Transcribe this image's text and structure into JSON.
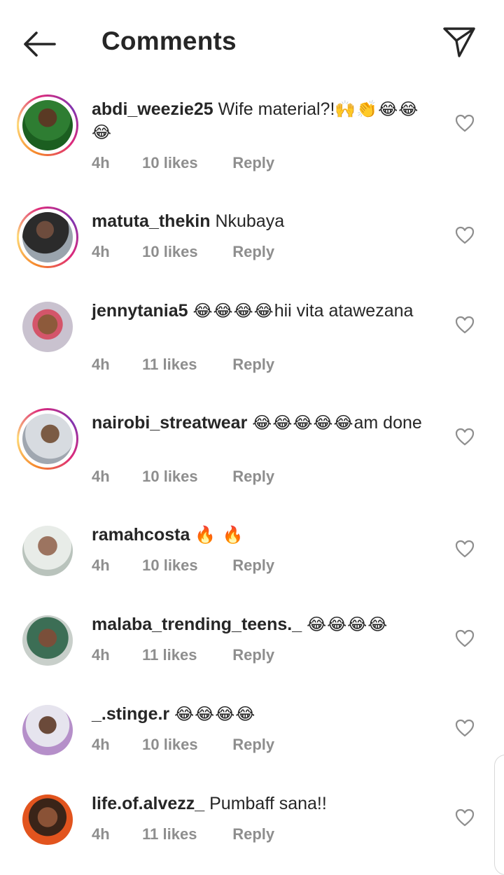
{
  "header": {
    "title": "Comments"
  },
  "comments": [
    {
      "username": "abdi_weezie25",
      "text": "Wife material?!",
      "emoji": "🙌👏😂😂😂",
      "time": "4h",
      "likes": "10 likes",
      "reply": "Reply",
      "story_ring": true
    },
    {
      "username": "matuta_thekin",
      "text": "Nkubaya",
      "emoji": "",
      "time": "4h",
      "likes": "10 likes",
      "reply": "Reply",
      "story_ring": true
    },
    {
      "username": "jennytania5",
      "text": "hii vita atawezana",
      "emoji": "😂😂😂😂",
      "time": "4h",
      "likes": "11 likes",
      "reply": "Reply",
      "story_ring": false
    },
    {
      "username": "nairobi_streatwear",
      "text": "am done",
      "emoji": "😂😂😂😂😂",
      "time": "4h",
      "likes": "10 likes",
      "reply": "Reply",
      "story_ring": true
    },
    {
      "username": "ramahcosta",
      "text": "",
      "emoji": "🔥 🔥",
      "time": "4h",
      "likes": "10 likes",
      "reply": "Reply",
      "story_ring": false
    },
    {
      "username": "malaba_trending_teens._",
      "text": "",
      "emoji": "😂😂😂😂",
      "time": "4h",
      "likes": "11 likes",
      "reply": "Reply",
      "story_ring": false
    },
    {
      "username": "_.stinge.r",
      "text": "",
      "emoji": "😂😂😂😂",
      "time": "4h",
      "likes": "10 likes",
      "reply": "Reply",
      "story_ring": false
    },
    {
      "username": "life.of.alvezz_",
      "text": "Pumbaff sana!!",
      "emoji": "",
      "time": "4h",
      "likes": "11 likes",
      "reply": "Reply",
      "story_ring": false
    }
  ],
  "colors": {
    "primary_text": "#262626",
    "secondary_text": "#8e8e8e",
    "story_ring_start": "#f58529",
    "story_ring_end": "#dd2a7b"
  },
  "icons": {
    "back": "arrow-left-icon",
    "send": "paper-plane-icon",
    "like": "heart-outline-icon"
  }
}
